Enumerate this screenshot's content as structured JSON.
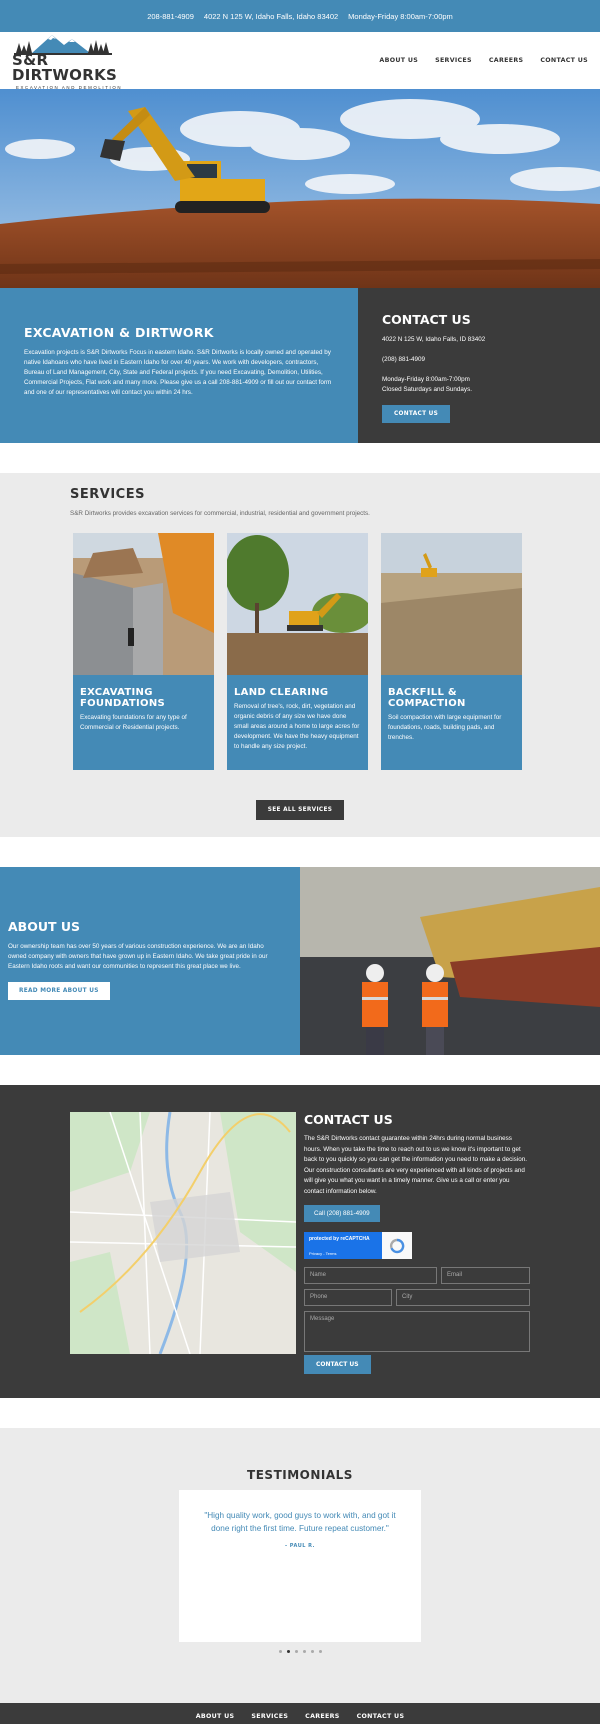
{
  "topbar": {
    "phone": "208-881-4909",
    "address": "4022 N 125 W, Idaho Falls, Idaho 83402",
    "hours": "Monday-Friday 8:00am-7:00pm"
  },
  "header": {
    "logo_name": "S&R DIRTWORKS",
    "logo_tagline": "EXCAVATION AND DEMOLITION",
    "nav": [
      "ABOUT US",
      "SERVICES",
      "CAREERS",
      "CONTACT US"
    ]
  },
  "intro": {
    "title": "EXCAVATION & DIRTWORK",
    "body": "Excavation projects is S&R Dirtworks Focus in eastern Idaho. S&R Dirtworks is locally owned and operated by native Idahoans who have lived in Eastern Idaho for over 40 years. We work with developers, contractors, Bureau of Land Management, City, State and Federal projects. If you need Excavating, Demolition, Utilities, Commercial Projects, Flat work and many more. Please give us a call 208-881-4909 or fill out our contact form and one of our representatives will contact you within 24 hrs.",
    "contact_title": "CONTACT US",
    "contact_address": "4022 N 125 W, Idaho Falls, ID 83402",
    "contact_phone": "(208) 881-4909",
    "contact_hours": "Monday-Friday 8:00am-7:00pm",
    "contact_closed": "Closed Saturdays and Sundays.",
    "contact_button": "CONTACT US"
  },
  "services": {
    "title": "SERVICES",
    "subtitle": "S&R Dirtworks provides excavation services for commercial, industrial, residential and government projects.",
    "cards": [
      {
        "title": "EXCAVATING FOUNDATIONS",
        "body": "Excavating foundations for any type of Commercial or Residential projects."
      },
      {
        "title": "LAND CLEARING",
        "body": "Removal of tree's, rock, dirt, vegetation and organic debris of any size we have done small areas around a home to large acres for development. We have the heavy equipment to handle any size project."
      },
      {
        "title": "BACKFILL & COMPACTION",
        "body": "Soil compaction with large equipment for foundations, roads, building pads, and trenches."
      }
    ],
    "button": "SEE ALL SERVICES"
  },
  "about": {
    "title": "ABOUT US",
    "body": "Our ownership team has over 50 years of various construction experience. We are an Idaho owned company with owners that have grown up in Eastern Idaho. We take great pride in our Eastern Idaho roots and want our communities to represent this great place we live.",
    "button": "READ MORE ABOUT US"
  },
  "contact": {
    "title": "CONTACT US",
    "body": "The S&R Dirtworks contact guarantee within 24hrs during normal business hours. When you take the time to reach out to us we know it's important to get back to you quickly so you can get the information you need to make a decision. Our construction consultants are very experienced with all kinds of projects and will give you what you want in a timely manner. Give us a call or enter you contact information below.",
    "call_button": "Call (208) 881-4909",
    "captcha_title": "protected by reCAPTCHA",
    "captcha_links": "Privacy - Terms",
    "placeholders": {
      "name": "Name",
      "email": "Email",
      "phone": "Phone",
      "city": "City",
      "message": "Message"
    },
    "submit": "CONTACT US"
  },
  "testimonials": {
    "title": "TESTIMONIALS",
    "quote": "\"High quality work, good guys to work with, and got it done right the first time. Future repeat customer.\"",
    "author": "- PAUL R.",
    "slide_count": 6,
    "active_slide": 2
  },
  "footer": {
    "nav": [
      "ABOUT US",
      "SERVICES",
      "CAREERS",
      "CONTACT US"
    ]
  },
  "colors": {
    "brand_blue": "#448ab6",
    "dark_gray": "#3b3b3b",
    "light_gray": "#ebebeb"
  }
}
